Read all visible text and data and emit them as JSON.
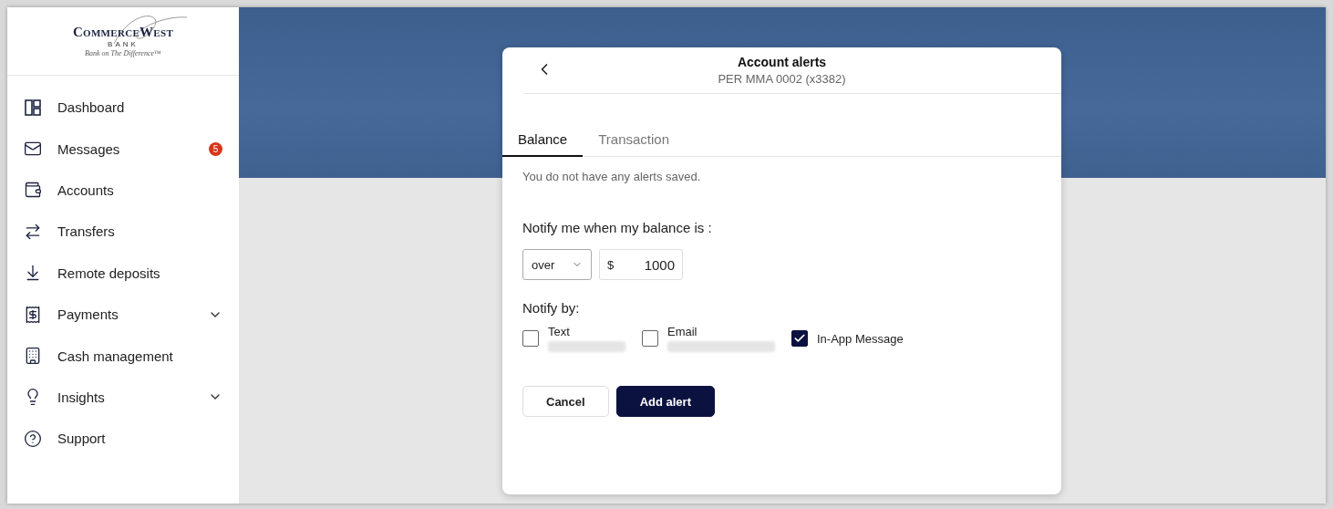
{
  "logo": {
    "name": "CommerceWest",
    "sub": "BANK",
    "tagline": "Bank on The Difference™"
  },
  "sidebar": {
    "items": [
      {
        "label": "Dashboard",
        "expandable": false
      },
      {
        "label": "Messages",
        "expandable": false,
        "badge": "5"
      },
      {
        "label": "Accounts",
        "expandable": false
      },
      {
        "label": "Transfers",
        "expandable": false
      },
      {
        "label": "Remote deposits",
        "expandable": false
      },
      {
        "label": "Payments",
        "expandable": true
      },
      {
        "label": "Cash management",
        "expandable": false
      },
      {
        "label": "Insights",
        "expandable": true
      },
      {
        "label": "Support",
        "expandable": false
      }
    ]
  },
  "dialog": {
    "title": "Account alerts",
    "subtitle": "PER MMA 0002 (x3382)",
    "tabs": [
      {
        "label": "Balance",
        "selected": true
      },
      {
        "label": "Transaction",
        "selected": false
      }
    ],
    "empty_message": "You do not have any alerts saved.",
    "condition_label": "Notify me when my balance is :",
    "condition": {
      "value": "over"
    },
    "amount": {
      "currency": "$",
      "value": "1000"
    },
    "notify_label": "Notify by:",
    "channels": [
      {
        "label": "Text",
        "checked": false,
        "redacted": true
      },
      {
        "label": "Email",
        "checked": false,
        "redacted": true
      },
      {
        "label": "In-App Message",
        "checked": true,
        "redacted": false
      }
    ],
    "buttons": [
      {
        "label": "Cancel",
        "kind": "secondary"
      },
      {
        "label": "Add alert",
        "kind": "primary"
      }
    ]
  }
}
